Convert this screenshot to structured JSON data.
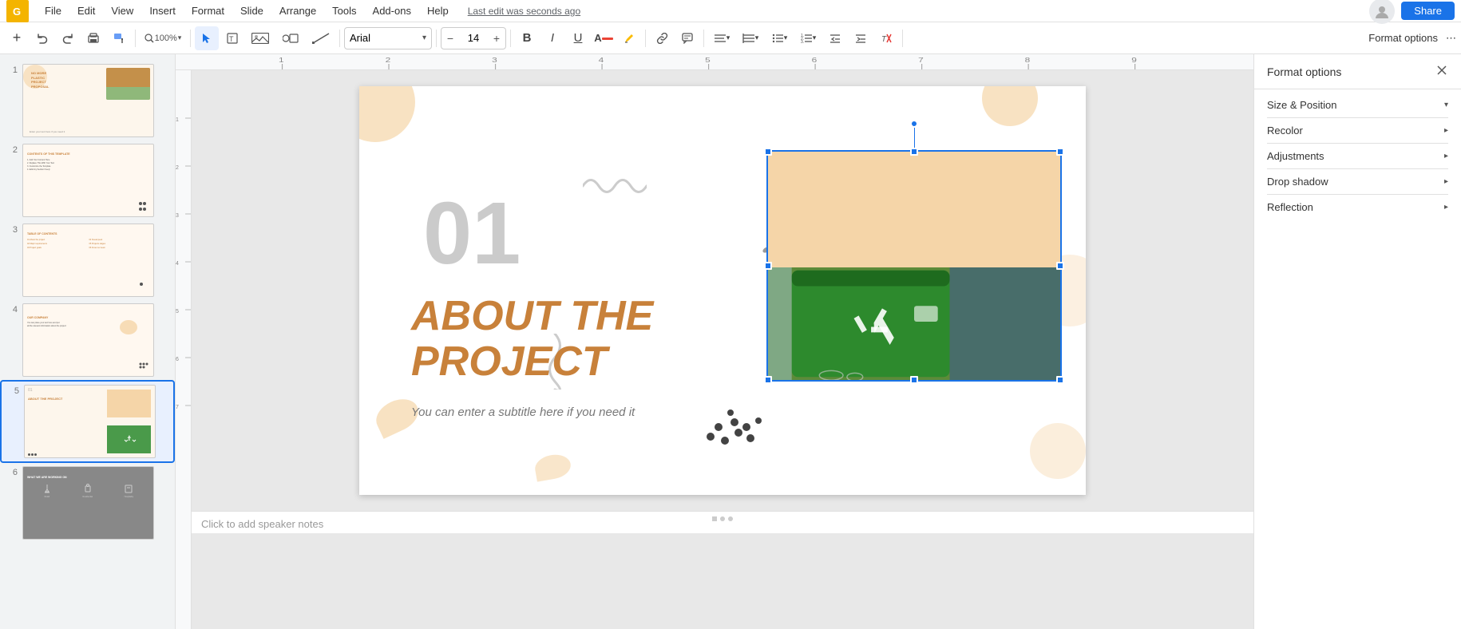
{
  "app": {
    "logo_letter": "G",
    "last_edit": "Last edit was seconds ago"
  },
  "menu": {
    "items": [
      "File",
      "Edit",
      "View",
      "Insert",
      "Format",
      "Slide",
      "Arrange",
      "Tools",
      "Add-ons",
      "Help"
    ]
  },
  "toolbar": {
    "font_name": "Arial",
    "font_size": "14",
    "format_options_label": "Format options",
    "more_label": "⋯"
  },
  "slides": [
    {
      "number": "1",
      "label": "Slide 1 - No More Plastic"
    },
    {
      "number": "2",
      "label": "Slide 2 - Contents"
    },
    {
      "number": "3",
      "label": "Slide 3 - Table of Contents"
    },
    {
      "number": "4",
      "label": "Slide 4 - Our Company"
    },
    {
      "number": "5",
      "label": "Slide 5 - About the Project"
    },
    {
      "number": "6",
      "label": "Slide 6 - What We Are Working On"
    }
  ],
  "main_slide": {
    "number": "01",
    "title_line1": "ABOUT THE",
    "title_line2": "PROJECT",
    "subtitle": "You can enter a subtitle here if you need it"
  },
  "notes": {
    "placeholder": "Click to add speaker notes"
  },
  "format_panel": {
    "title": "Format options"
  },
  "thumb_labels": {
    "slide1_line1": "NO MORE",
    "slide1_line2": "PLASTIC",
    "slide1_line3": "PROJECT",
    "slide1_line4": "PROPOSAL",
    "slide2_text": "CONTENTS OF THIS TEMPLATE",
    "slide3_text": "TABLE OF CONTENTS",
    "slide4_text": "OUR COMPANY",
    "slide5_num": "01",
    "slide5_about": "ABOUT THE PROJECT",
    "slide6_text": "WHAT WE ARE WORKING ON"
  },
  "icons": {
    "undo": "↩",
    "redo": "↪",
    "print": "🖨",
    "paint_format": "🖌",
    "zoom": "🔍",
    "cursor": "↖",
    "text_box": "T",
    "image": "🖼",
    "shapes": "◯",
    "line": "╲",
    "bold": "B",
    "italic": "I",
    "underline": "U",
    "font_color": "A",
    "highlight": "✏",
    "link": "🔗",
    "comment": "💬",
    "align": "≡",
    "line_spacing": "↕",
    "list_bullet": "☰",
    "list_number": "①",
    "list_indent": "→",
    "list_indent2": "←",
    "indent_more": "⇥",
    "indent_less": "⇤",
    "clear": "✕",
    "more": "⋯",
    "close": "✕",
    "plus": "+",
    "minus": "−",
    "chevron_down": "▾"
  }
}
